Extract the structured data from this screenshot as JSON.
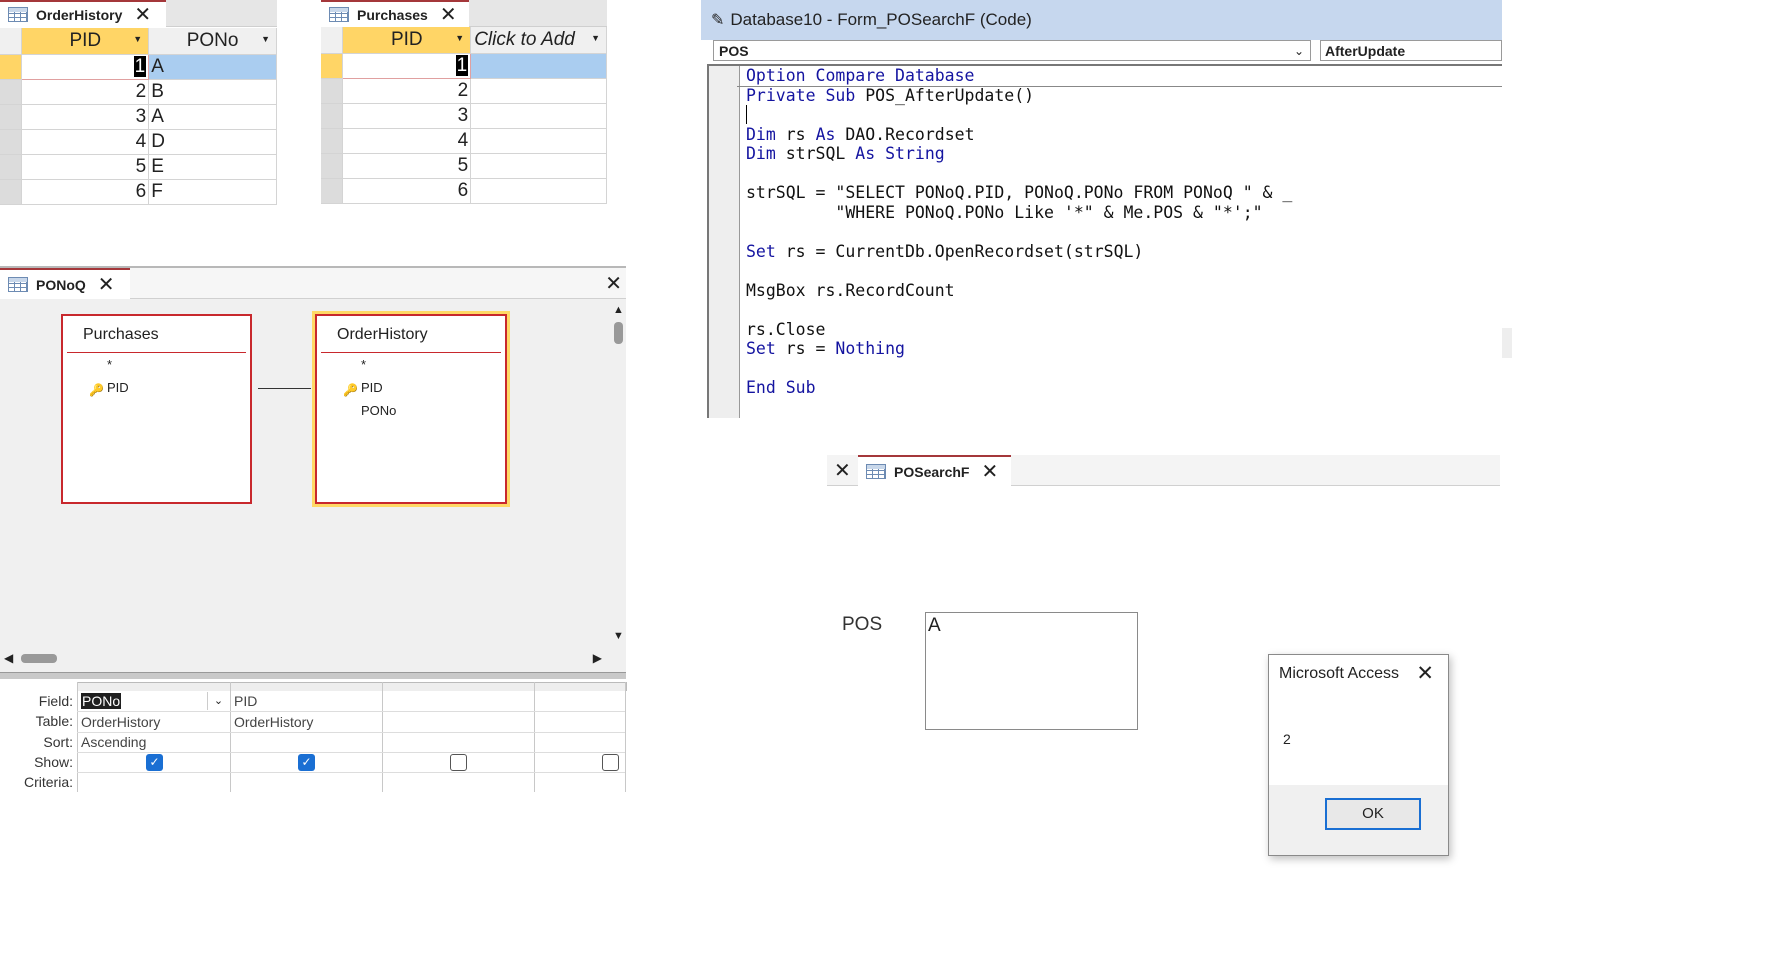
{
  "order_history_table": {
    "tab_label": "OrderHistory",
    "columns": [
      "PID",
      "PONo"
    ],
    "rows": [
      {
        "pid": "1",
        "pono": "A"
      },
      {
        "pid": "2",
        "pono": "B"
      },
      {
        "pid": "3",
        "pono": "A"
      },
      {
        "pid": "4",
        "pono": "D"
      },
      {
        "pid": "5",
        "pono": "E"
      },
      {
        "pid": "6",
        "pono": "F"
      }
    ]
  },
  "purchases_table": {
    "tab_label": "Purchases",
    "columns": [
      "PID",
      "Click to Add"
    ],
    "rows": [
      "1",
      "2",
      "3",
      "4",
      "5",
      "6"
    ]
  },
  "query_designer": {
    "tab_label": "PONoQ",
    "tables": [
      {
        "name": "Purchases",
        "fields": [
          "*",
          "PID"
        ]
      },
      {
        "name": "OrderHistory",
        "fields": [
          "*",
          "PID",
          "PONo"
        ]
      }
    ],
    "row_labels": {
      "field": "Field:",
      "table": "Table:",
      "sort": "Sort:",
      "show": "Show:",
      "criteria": "Criteria:"
    },
    "columns": [
      {
        "field": "PONo",
        "table": "OrderHistory",
        "sort": "Ascending",
        "show": true
      },
      {
        "field": "PID",
        "table": "OrderHistory",
        "sort": "",
        "show": true
      },
      {
        "field": "",
        "table": "",
        "sort": "",
        "show": false
      },
      {
        "field": "",
        "table": "",
        "sort": "",
        "show": false
      }
    ]
  },
  "vba_editor": {
    "title": "Database10 - Form_POSearchF (Code)",
    "object_dropdown": "POS",
    "procedure_dropdown": "AfterUpdate",
    "code": {
      "l1a": "Option Compare Database",
      "l2a": "Private Sub",
      "l2b": " POS_AfterUpdate()",
      "l4a": "Dim",
      "l4b": " rs ",
      "l4c": "As",
      "l4d": " DAO.Recordset",
      "l5a": "Dim",
      "l5b": " strSQL ",
      "l5c": "As String",
      "l7": "strSQL = \"SELECT PONoQ.PID, PONoQ.PONo FROM PONoQ \" & _",
      "l8": "         \"WHERE PONoQ.PONo Like '*\" & Me.POS & \"*';\"",
      "l10a": "Set",
      "l10b": " rs = CurrentDb.OpenRecordset(strSQL)",
      "l12": "MsgBox rs.RecordCount",
      "l14": "rs.Close",
      "l15a": "Set",
      "l15b": " rs = ",
      "l15c": "Nothing",
      "l17": "End Sub"
    }
  },
  "form": {
    "tab_label": "POSearchF",
    "pos_label": "POS",
    "pos_value": "A"
  },
  "msgbox": {
    "title": "Microsoft Access",
    "message": "2",
    "ok_label": "OK"
  },
  "colors": {
    "accent": "#a4373a",
    "selected_header": "#ffd566",
    "row_highlight": "#aacdf0",
    "vba_keyword": "#1414a0"
  }
}
